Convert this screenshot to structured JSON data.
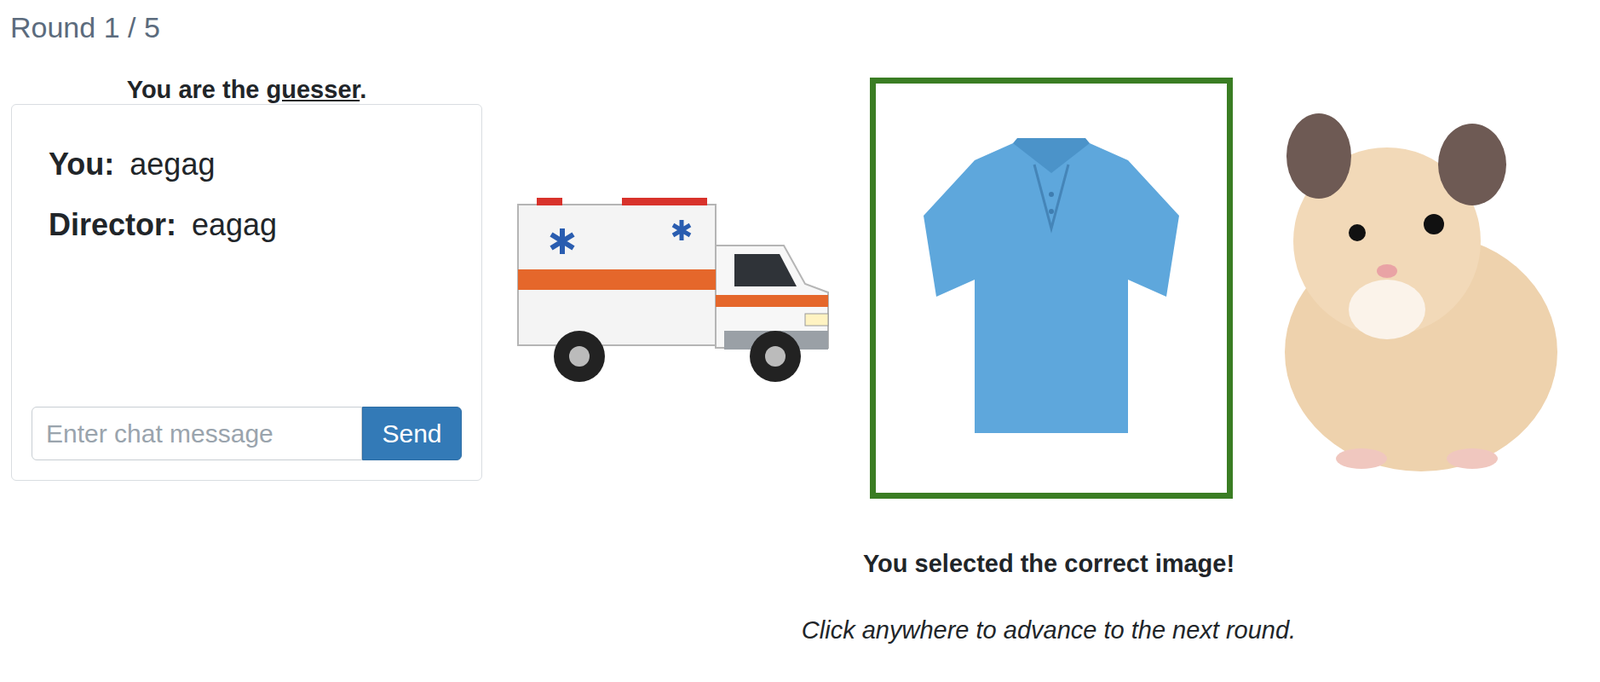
{
  "round": "Round 1 / 5",
  "role": {
    "prefix": "You are the ",
    "role": "guesser",
    "suffix": "."
  },
  "chat": {
    "messages": [
      {
        "speaker": "You:",
        "text": "aegag"
      },
      {
        "speaker": "Director:",
        "text": "eagag"
      }
    ],
    "input": {
      "placeholder": "Enter chat message"
    },
    "send": "Send"
  },
  "images": [
    {
      "kind": "ambulance",
      "selected": false
    },
    {
      "kind": "shirt",
      "selected": true
    },
    {
      "kind": "hamster",
      "selected": false
    }
  ],
  "feedback": "You selected the correct image!",
  "hint": "Click anywhere to advance to the next round."
}
